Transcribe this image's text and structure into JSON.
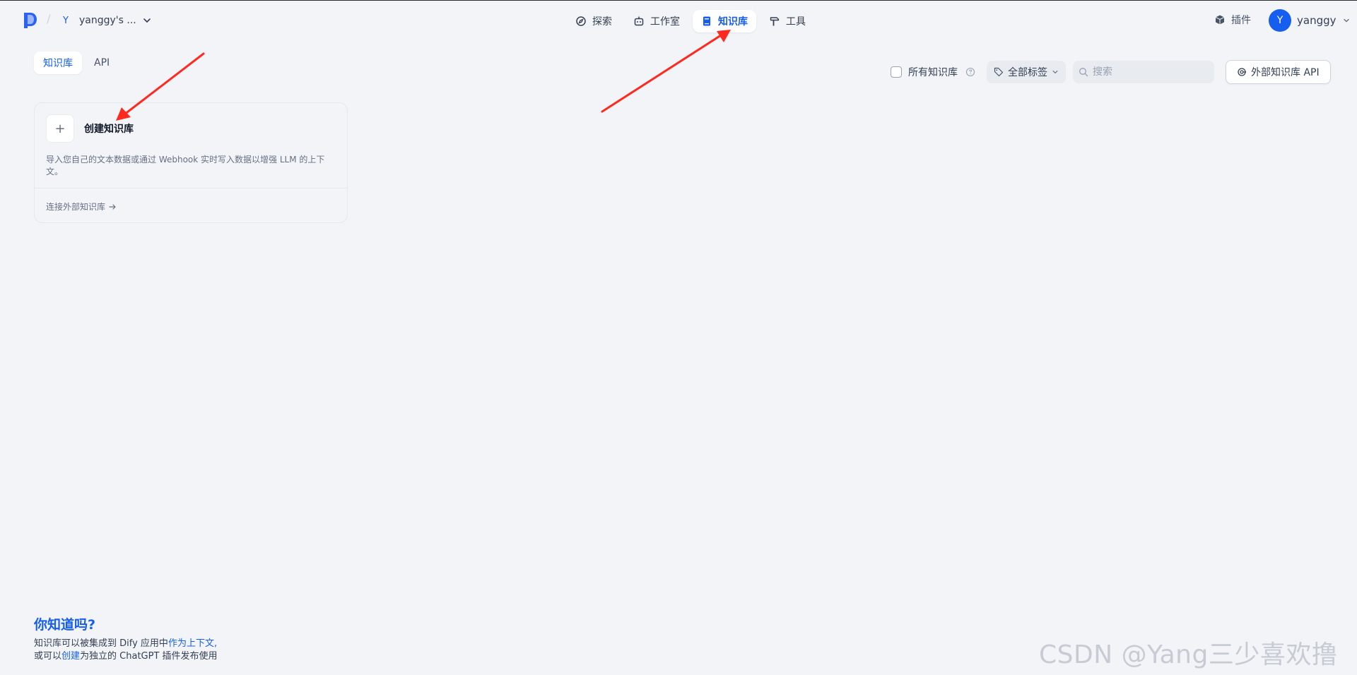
{
  "header": {
    "workspace": {
      "badge": "Y",
      "name": "yanggy's ..."
    },
    "nav": [
      {
        "label": "探索",
        "icon": "compass-icon",
        "active": false
      },
      {
        "label": "工作室",
        "icon": "robot-icon",
        "active": false
      },
      {
        "label": "知识库",
        "icon": "book-icon",
        "active": true
      },
      {
        "label": "工具",
        "icon": "hammer-icon",
        "active": false
      }
    ],
    "plugin_label": "插件",
    "user": {
      "avatar_letter": "Y",
      "name": "yanggy"
    }
  },
  "tabs": [
    {
      "label": "知识库",
      "active": true
    },
    {
      "label": "API",
      "active": false
    }
  ],
  "toolbar": {
    "all_datasets_label": "所有知识库",
    "all_datasets_checked": false,
    "tag_filter_label": "全部标签",
    "search_placeholder": "搜索",
    "search_value": "",
    "external_api_label": "外部知识库 API"
  },
  "create_card": {
    "plus": "+",
    "title": "创建知识库",
    "description": "导入您自己的文本数据或通过 Webhook 实时写入数据以增强 LLM 的上下文。",
    "connect_label": "连接外部知识库"
  },
  "tip": {
    "title": "你知道吗?",
    "line1_prefix": "知识库可以被集成到 Dify 应用中",
    "line1_link": "作为上下文,",
    "line2_prefix": "或可以",
    "line2_link": "创建",
    "line2_suffix": "为独立的 ChatGPT 插件发布使用"
  },
  "watermark": "CSDN @Yang三少喜欢撸铁",
  "colors": {
    "accent": "#155eef",
    "background": "#f2f4f7",
    "annotation_arrow": "#ff2a1f"
  }
}
